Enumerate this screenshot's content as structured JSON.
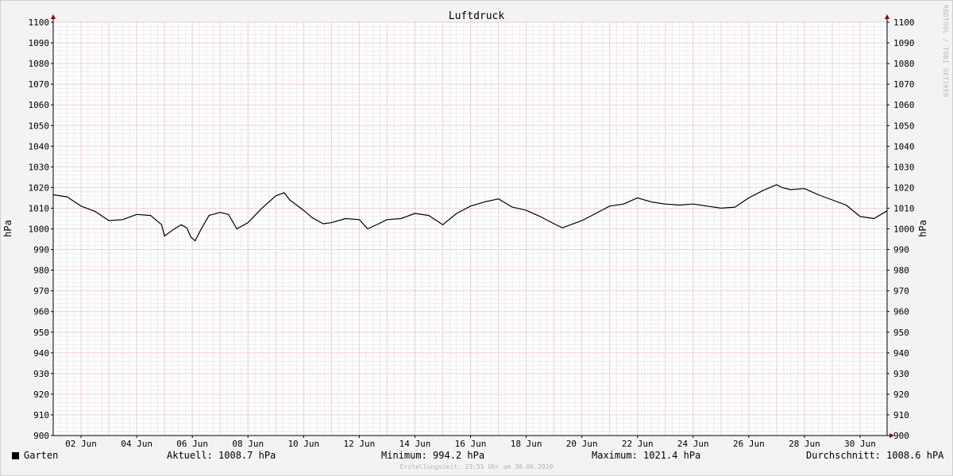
{
  "chart_data": {
    "type": "line",
    "title": "Luftdruck",
    "ylabel": "hPa",
    "ylim": [
      900,
      1100
    ],
    "yticks": [
      900,
      910,
      920,
      930,
      940,
      950,
      960,
      970,
      980,
      990,
      1000,
      1010,
      1020,
      1030,
      1040,
      1050,
      1060,
      1070,
      1080,
      1090,
      1100
    ],
    "x_tick_labels": [
      "02 Jun",
      "04 Jun",
      "06 Jun",
      "08 Jun",
      "10 Jun",
      "12 Jun",
      "14 Jun",
      "16 Jun",
      "18 Jun",
      "20 Jun",
      "22 Jun",
      "24 Jun",
      "26 Jun",
      "28 Jun",
      "30 Jun"
    ],
    "x_tick_days": [
      2,
      4,
      6,
      8,
      10,
      12,
      14,
      16,
      18,
      20,
      22,
      24,
      26,
      28,
      30
    ],
    "xlim": [
      1.0,
      30.97
    ],
    "grid": true,
    "series": [
      {
        "name": "Garten",
        "color": "#000000",
        "x": [
          1.0,
          1.5,
          2.0,
          2.5,
          3.0,
          3.5,
          4.0,
          4.5,
          4.9,
          5.0,
          5.3,
          5.6,
          5.8,
          5.95,
          6.1,
          6.3,
          6.6,
          7.0,
          7.3,
          7.6,
          8.0,
          8.5,
          9.0,
          9.3,
          9.5,
          10.0,
          10.3,
          10.7,
          11.0,
          11.5,
          12.0,
          12.3,
          12.7,
          13.0,
          13.5,
          14.0,
          14.5,
          15.0,
          15.5,
          16.0,
          16.5,
          17.0,
          17.5,
          18.0,
          18.5,
          19.0,
          19.3,
          19.5,
          20.0,
          20.5,
          21.0,
          21.5,
          22.0,
          22.5,
          23.0,
          23.5,
          24.0,
          24.5,
          25.0,
          25.5,
          26.0,
          26.5,
          27.0,
          27.2,
          27.5,
          28.0,
          28.5,
          29.0,
          29.5,
          30.0,
          30.5,
          30.97
        ],
        "y": [
          1016.5,
          1015.5,
          1011.0,
          1008.5,
          1004.0,
          1004.5,
          1007.0,
          1006.5,
          1002.0,
          996.5,
          999.5,
          1002.0,
          1000.5,
          996.0,
          994.2,
          999.5,
          1006.5,
          1008.0,
          1007.0,
          1000.0,
          1003.0,
          1010.0,
          1016.0,
          1017.5,
          1014.0,
          1009.0,
          1005.5,
          1002.5,
          1003.0,
          1005.0,
          1004.5,
          1000.0,
          1002.5,
          1004.5,
          1005.0,
          1007.5,
          1006.5,
          1002.0,
          1007.5,
          1011.0,
          1013.0,
          1014.5,
          1010.5,
          1009.0,
          1006.0,
          1002.5,
          1000.5,
          1001.5,
          1004.0,
          1007.5,
          1011.0,
          1012.0,
          1015.0,
          1013.0,
          1012.0,
          1011.5,
          1012.0,
          1011.0,
          1010.0,
          1010.5,
          1015.0,
          1018.5,
          1021.4,
          1020.0,
          1019.0,
          1019.5,
          1016.5,
          1014.0,
          1011.5,
          1006.0,
          1005.0,
          1008.7
        ]
      }
    ]
  },
  "legend": {
    "series_name": "Garten",
    "current": "Aktuell: 1008.7 hPa",
    "minimum": "Minimum: 994.2 hPa",
    "maximum": "Maximum: 1021.4 hPa",
    "average": "Durchschnitt: 1008.6 hPA"
  },
  "footer": "Erstellungszeit: 23:55 Uhr am 30.06.2019",
  "watermark": "RRDTOOL / TOBI OETIKER",
  "colors": {
    "background": "#f3f3f3",
    "plot_background": "#ffffff",
    "minor_grid": "#dcdcdc",
    "major_grid": "#e8a0a0",
    "axis_arrow": "#8b0000"
  }
}
